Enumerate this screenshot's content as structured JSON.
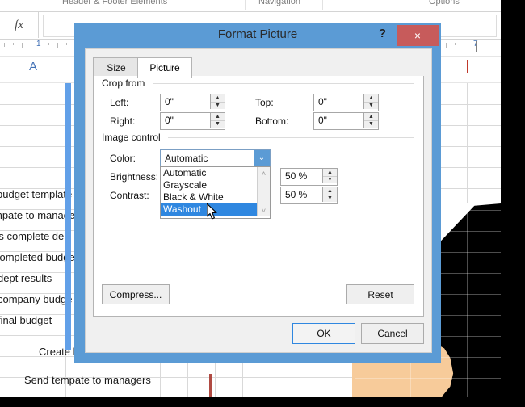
{
  "app": {
    "ribbon_groups": [
      "Header & Footer Elements",
      "Navigation",
      "Options"
    ],
    "fx_label": "fx",
    "formula_value": "",
    "header_letter": "A",
    "ruler_marks": [
      "1",
      "7"
    ],
    "sheet_rows": [
      "budget template",
      "mpate to manage",
      "rs complete dep",
      "completed budge",
      "dept results",
      "company budge",
      "final budget",
      "",
      "Create b",
      "Send tempate to managers"
    ]
  },
  "dialog": {
    "title": "Format Picture",
    "help_label": "?",
    "close_label": "×",
    "tabs": [
      {
        "label": "Size",
        "active": false
      },
      {
        "label": "Picture",
        "active": true
      }
    ],
    "crop_group": {
      "legend": "Crop from",
      "fields": [
        {
          "label": "Left:",
          "accel": "L",
          "value": "0\""
        },
        {
          "label": "Top:",
          "accel": "T",
          "value": "0\""
        },
        {
          "label": "Right:",
          "accel": "R",
          "value": "0\""
        },
        {
          "label": "Bottom:",
          "accel": "B",
          "value": "0\""
        }
      ]
    },
    "image_control_group": {
      "legend": "Image control",
      "color_label": "Color:",
      "color_value": "Automatic",
      "brightness_label": "Brightness:",
      "brightness_value": "50 %",
      "contrast_label": "Contrast:",
      "contrast_value": "50 %",
      "color_options": [
        "Automatic",
        "Grayscale",
        "Black & White",
        "Washout"
      ],
      "color_selected": "Washout"
    },
    "buttons": {
      "compress": "Compress...",
      "reset": "Reset",
      "ok": "OK",
      "cancel": "Cancel"
    },
    "spinner_up": "▲",
    "spinner_down": "▼",
    "combo_arrow": "⌄",
    "scroll_up": "˄",
    "scroll_down": "˅"
  },
  "colors": {
    "title_bar": "#5b9bd5",
    "close_button": "#c75b5b",
    "selection": "#2f87e0",
    "accent_blue": "#62a0e8",
    "skin": "#f7cb9a"
  }
}
